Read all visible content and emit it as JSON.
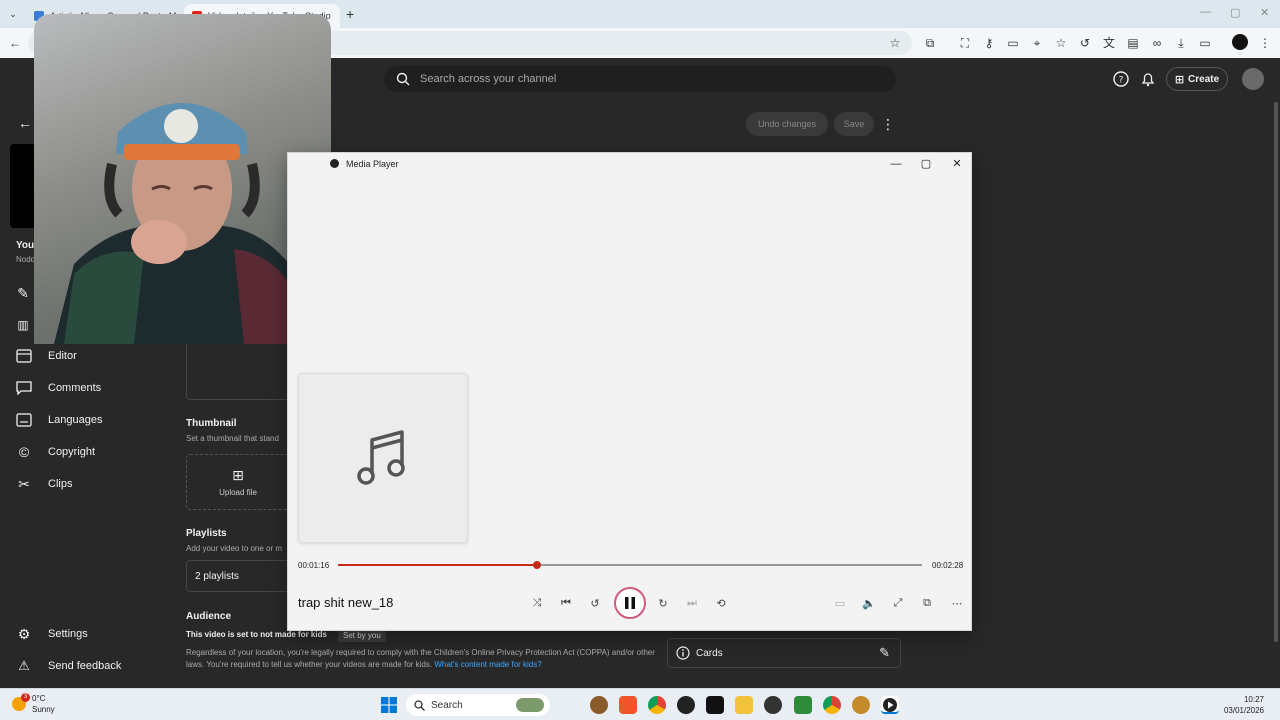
{
  "browser": {
    "tabs": [
      {
        "title": "Artistic Album Covers | PosterM",
        "active": false
      },
      {
        "title": "Video details - YouTube Studio",
        "active": true
      }
    ],
    "new_tab": "+"
  },
  "studio": {
    "search_placeholder": "Search across your channel",
    "create_label": "Create",
    "undo_label": "Undo changes",
    "save_label": "Save",
    "sidebar": {
      "your_video_label": "Your",
      "channel_name": "Nodd",
      "items": [
        {
          "label": "Editor",
          "icon": "editor-icon"
        },
        {
          "label": "Comments",
          "icon": "comments-icon"
        },
        {
          "label": "Languages",
          "icon": "languages-icon"
        },
        {
          "label": "Copyright",
          "icon": "copyright-icon"
        },
        {
          "label": "Clips",
          "icon": "scissors-icon"
        }
      ],
      "settings_label": "Settings",
      "feedback_label": "Send feedback"
    },
    "thumbnail": {
      "title": "Thumbnail",
      "subtitle": "Set a thumbnail that stand",
      "upload_label": "Upload file"
    },
    "playlists": {
      "title": "Playlists",
      "subtitle": "Add your video to one or m",
      "value": "2 playlists"
    },
    "audience": {
      "title": "Audience",
      "made_for_kids": "This video is set to not made for kids",
      "badge": "Set by you",
      "text": "Regardless of your location, you're legally required to comply with the Children's Online Privacy Protection Act (COPPA) and/or other laws. You're required to tell us whether your videos are made for kids.",
      "link": "What's content made for kids?"
    },
    "cards_label": "Cards"
  },
  "media_player": {
    "title": "Media Player",
    "song_title": "trap shit new_18",
    "elapsed": "00:01:16",
    "duration": "00:02:28",
    "progress_fraction": 0.34
  },
  "taskbar": {
    "weather_temp": "0°C",
    "weather_desc": "Sunny",
    "weather_badge": "3",
    "search_label": "Search",
    "time": "10:27",
    "date": "03/01/2026"
  },
  "colors": {
    "accent_red": "#c42b1c",
    "studio_bg": "#282828",
    "link_blue": "#3ea6ff"
  }
}
